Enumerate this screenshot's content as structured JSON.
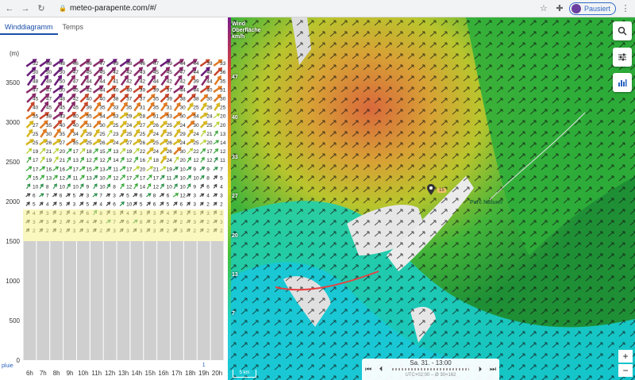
{
  "browser": {
    "url": "meteo-parapente.com/#/",
    "profile_label": "Pausiert"
  },
  "tabs": [
    {
      "label": "Winddiagramm",
      "active": true
    },
    {
      "label": "Temps",
      "active": false
    }
  ],
  "chart_data": {
    "type": "heatmap",
    "ylabel": "(m)",
    "y_ticks": [
      0,
      500,
      1000,
      1500,
      2000,
      2500,
      3000,
      3500
    ],
    "x_ticks": [
      "6h",
      "7h",
      "8h",
      "9h",
      "10h",
      "11h",
      "12h",
      "13h",
      "14h",
      "15h",
      "16h",
      "17h",
      "18h",
      "19h",
      "20h"
    ],
    "rain_label": "pluie",
    "rain_values": [
      "",
      "",
      "",
      "",
      "",
      "",
      "",
      "",
      "",
      "",
      "",
      "",
      "",
      "1",
      ""
    ],
    "ground_level_m": 1500,
    "speed_rows_top_to_bottom": [
      [
        52,
        48,
        48,
        46,
        46,
        47,
        49,
        48,
        46,
        47,
        49,
        44,
        44,
        39,
        33
      ],
      [
        50,
        50,
        50,
        47,
        45,
        45,
        42,
        42,
        43,
        45,
        45,
        47,
        44,
        48,
        36
      ],
      [
        48,
        49,
        50,
        47,
        44,
        44,
        41,
        42,
        42,
        44,
        42,
        42,
        39,
        44,
        35
      ],
      [
        47,
        47,
        50,
        45,
        42,
        44,
        40,
        40,
        39,
        39,
        37,
        44,
        44,
        40,
        31
      ],
      [
        45,
        47,
        48,
        42,
        40,
        40,
        38,
        37,
        37,
        35,
        39,
        38,
        38,
        30,
        30
      ],
      [
        40,
        45,
        45,
        45,
        39,
        35,
        33,
        35,
        31,
        35,
        31,
        30,
        25,
        26,
        25
      ],
      [
        35,
        38,
        43,
        40,
        35,
        34,
        33,
        29,
        28,
        31,
        33,
        30,
        34,
        24,
        20
      ],
      [
        27,
        35,
        40,
        40,
        31,
        30,
        25,
        24,
        27,
        26,
        25,
        24,
        30,
        25,
        20
      ],
      [
        25,
        30,
        35,
        34,
        29,
        25,
        23,
        25,
        25,
        24,
        25,
        29,
        24,
        21,
        13
      ],
      [
        25,
        26,
        27,
        35,
        25,
        26,
        24,
        27,
        26,
        25,
        26,
        24,
        25,
        20,
        14
      ],
      [
        19,
        21,
        20,
        17,
        18,
        15,
        13,
        19,
        22,
        24,
        26,
        30,
        22,
        17,
        12
      ],
      [
        17,
        19,
        21,
        13,
        12,
        12,
        14,
        12,
        16,
        18,
        24,
        20,
        12,
        12,
        11
      ],
      [
        17,
        16,
        16,
        17,
        15,
        13,
        11,
        17,
        20,
        21,
        19,
        10,
        9,
        9,
        7
      ],
      [
        15,
        13,
        12,
        11,
        13,
        10,
        12,
        17,
        17,
        17,
        11,
        10,
        10,
        8,
        5
      ],
      [
        10,
        8,
        10,
        10,
        9,
        10,
        8,
        12,
        14,
        12,
        10,
        10,
        9,
        6,
        4
      ],
      [
        6,
        7,
        6,
        5,
        3,
        7,
        3,
        5,
        6,
        8,
        6,
        12,
        3,
        4,
        3
      ],
      [
        5,
        4,
        5,
        3,
        5,
        4,
        6,
        10,
        5,
        6,
        5,
        6,
        3,
        2,
        2
      ],
      [
        4,
        3,
        2,
        4,
        6,
        8,
        5,
        4,
        3,
        3,
        4,
        3,
        5,
        3,
        2
      ],
      [
        3,
        3,
        2,
        3,
        4,
        3,
        7,
        6,
        8,
        3,
        2,
        2,
        3,
        2,
        3
      ],
      [
        2,
        2,
        2,
        3,
        3,
        2,
        3,
        3,
        3,
        3,
        2,
        3,
        2,
        2,
        2
      ]
    ]
  },
  "map": {
    "legend_title": "Wind Oberfläche km/h",
    "legend_values": [
      "47",
      "40",
      "33",
      "27",
      "20",
      "13",
      "7"
    ],
    "scale_label": "5 km",
    "marker_label": "15",
    "place_label": "Parc Naturel",
    "player_date": "Sa. 31. - 13:00",
    "player_sub": "UTC+02:00 – Ø 30×162",
    "zoom_in": "+",
    "zoom_out": "−",
    "colors": {
      "high": "#c8573a",
      "mid": "#d8c12a",
      "low": "#2fbf3a",
      "valley": "#1bcfd0",
      "snow": "#e8e8e8"
    }
  }
}
